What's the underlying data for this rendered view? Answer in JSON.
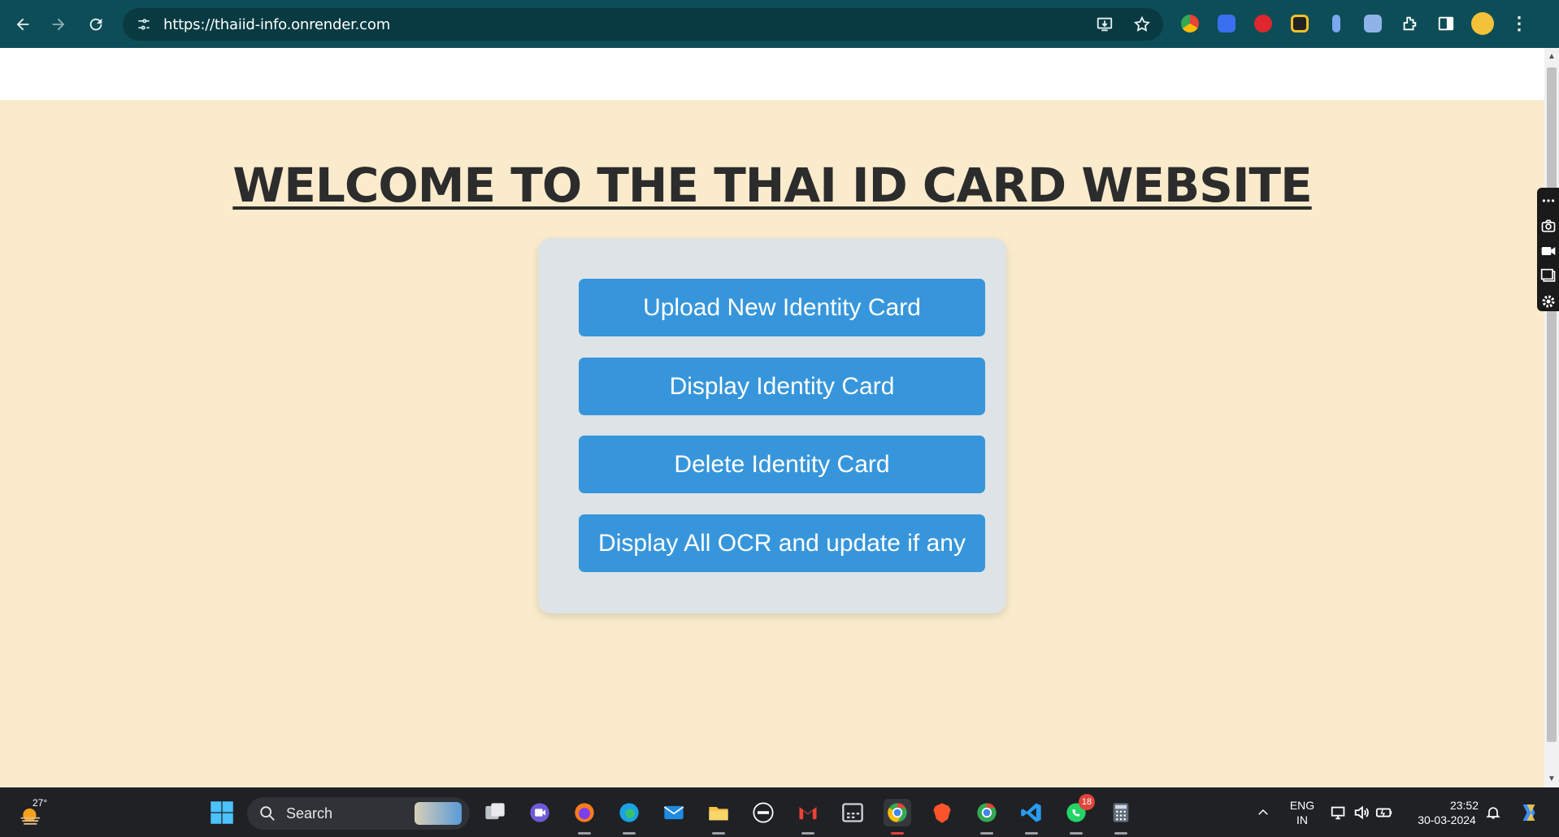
{
  "browser": {
    "url": "https://thaiid-info.onrender.com"
  },
  "page": {
    "title": "WELCOME TO THE THAI ID CARD WEBSITE",
    "buttons": [
      "Upload New Identity Card",
      "Display Identity Card",
      "Delete Identity Card",
      "Display All OCR and update if any"
    ]
  },
  "taskbar": {
    "weather_temp": "27°",
    "search_label": "Search",
    "whatsapp_badge": "18",
    "lang_top": "ENG",
    "lang_bottom": "IN",
    "time": "23:52",
    "date": "30-03-2024"
  },
  "colors": {
    "browser_bar": "#0d4d57",
    "page_bg": "#f9ebcc",
    "panel_bg": "#dde3e6",
    "button_bg": "#3796db"
  }
}
